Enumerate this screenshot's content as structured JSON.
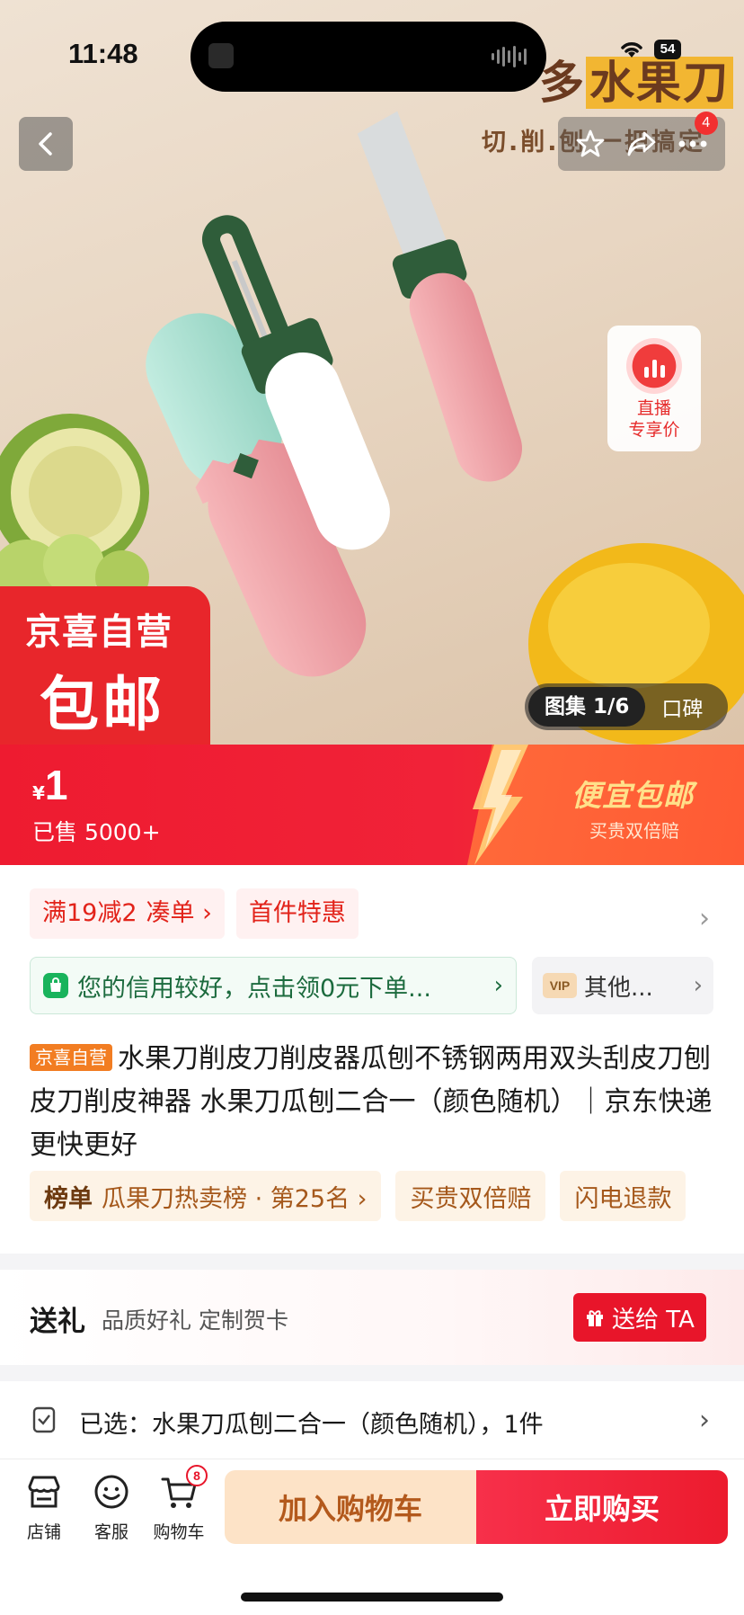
{
  "status_bar": {
    "time": "11:48",
    "battery": "54"
  },
  "hero": {
    "banner_title_plain": "多",
    "banner_title_highlight": "水果刀",
    "banner_subtitle": "切.削.刨 一把搞定",
    "cart_count_badge": "4",
    "live_line1": "直播",
    "live_line2": "专享价",
    "brand_badge_top": "京喜自营",
    "brand_badge_bottom": "包邮",
    "gallery_active": "图集 1/6",
    "gallery_other": "口碑",
    "icons": {
      "back": "chevron-left-icon",
      "star": "star-icon",
      "share": "share-icon",
      "more": "more-icon",
      "live": "live-icon"
    }
  },
  "price": {
    "currency": "¥",
    "value": "1",
    "sold": "已售 5000+",
    "promo_title": "便宜包邮",
    "promo_sub": "买贵双倍赔"
  },
  "coupons": {
    "discount": "满19减2",
    "gather": "凑单 ›",
    "first_item": "首件特惠",
    "chevron": "›"
  },
  "credit": {
    "text": "您的信用较好，点击领0元下单...",
    "arrow": "›",
    "vip_tag": "VIP",
    "vip_text": "其他...",
    "vip_arrow": "›"
  },
  "product": {
    "tag": "京喜自营",
    "title": "水果刀削皮刀削皮器瓜刨不锈钢两用双头刮皮刀刨皮刀削皮神器 水果刀瓜刨二合一（颜色随机）｜京东快递 更快更好"
  },
  "rank": {
    "label": "榜单",
    "detail": "瓜果刀热卖榜 · 第25名 ›",
    "chip2": "买贵双倍赔",
    "chip3": "闪电退款"
  },
  "gift": {
    "title": "送礼",
    "subtitle": "品质好礼 定制贺卡",
    "button": "送给 TA"
  },
  "selected": {
    "text": "已选：水果刀瓜刨二合一（颜色随机），1件",
    "arrow": "›"
  },
  "bottom_bar": {
    "store_label": "店铺",
    "service_label": "客服",
    "cart_label": "购物车",
    "cart_badge": "8",
    "add_to_cart": "加入购物车",
    "buy_now": "立即购买"
  },
  "colors": {
    "brand_red": "#e8152a",
    "price_bar": "#ee1b30",
    "promo_orange": "#ff5a34",
    "credit_green": "#19b35c",
    "cart_button_bg": "#fde3c7"
  }
}
